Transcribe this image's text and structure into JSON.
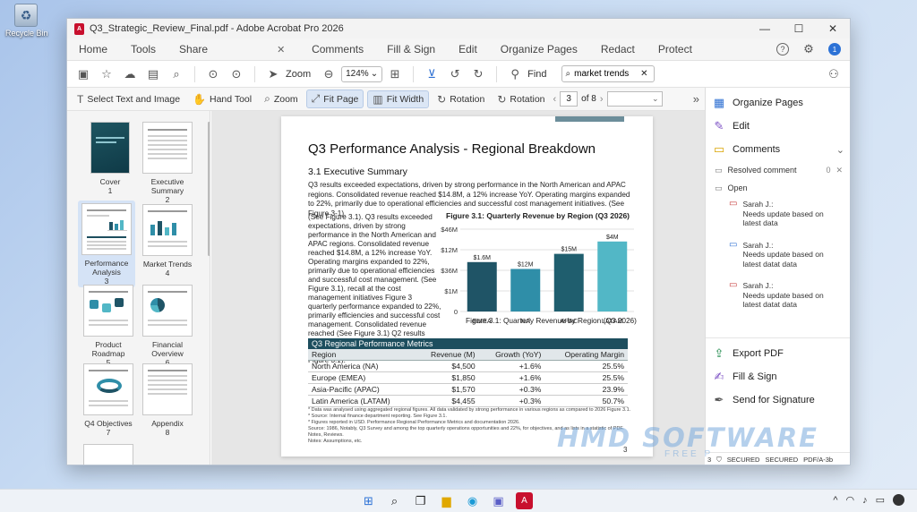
{
  "desktop": {
    "recycle_label": "Recycle Bin"
  },
  "window": {
    "title": "Q3_Strategic_Review_Final.pdf - Adobe Acrobat Pro 2026",
    "controls": {
      "minimize": "—",
      "maximize": "☐",
      "close": "✕"
    }
  },
  "menubar": {
    "left_tabs": [
      "Home",
      "Tools",
      "Share"
    ],
    "close_tab": "✕",
    "right_tabs": [
      "Comments",
      "Fill & Sign",
      "Edit",
      "Organize Pages",
      "Redact",
      "Protect"
    ],
    "help": "?",
    "user_initial": "1"
  },
  "toolbar1": {
    "zoom_label": "Zoom",
    "zoom_value": "124%",
    "find_label": "Find",
    "search_value": "market trends"
  },
  "toolbar2": {
    "select": "Select Text and Image",
    "hand": "Hand Tool",
    "zoom": "Zoom",
    "fit_page": "Fit Page",
    "fit_width": "Fit Width",
    "rotation1": "Rotation",
    "rotation2": "Rotation",
    "page_current": "3",
    "page_of": "of 8",
    "more": "»"
  },
  "thumbnails": [
    {
      "name": "Cover",
      "num": "1"
    },
    {
      "name": "Executive Summary",
      "num": "2"
    },
    {
      "name": "Performance Analysis",
      "num": "3"
    },
    {
      "name": "Market Trends",
      "num": "4"
    },
    {
      "name": "Product Roadmap",
      "num": "5"
    },
    {
      "name": "Financial Overview",
      "num": "6"
    },
    {
      "name": "Q4 Objectives",
      "num": "7"
    },
    {
      "name": "Appendix",
      "num": "8"
    }
  ],
  "document": {
    "title": "Q3 Performance Analysis - Regional Breakdown",
    "section": "3.1  Executive Summary",
    "paragraph": "Q3 results exceeded expectations, driven by strong performance in the North American and APAC regions. Consolidated revenue reached $14.8M, a 12% increase YoY. Operating margins expanded to 22%, primarily due to operational efficiencies and successful cost management initiatives. (See Figure 3-1).",
    "left_text": "(See Figure 3.1). Q3 results exceeded expectations, driven by strong performance in the North American and APAC regions. Consolidated revenue reached $14.8M, a 12% increase YoY. Operating margins expanded to 22%, primarily due to operational efficiencies and successful cost management. (See Figure 3.1), recall at the cost management initiatives Figure 3 quarterly performance expanded to 22%, primarily efficiencies and successful cost management. Consolidated revenue reached (See Figure 3.1) Q2 results exceeded operational efficiencies and successful cost management. (See Figure 3.1).",
    "chart_caption": "Figure 3.1: Quarterly Revenue by Region (Q3 2026)",
    "page_footer_num": "3",
    "footnotes": [
      "* Data was analysed using aggregated regional figures. All data validated by strong performance in various regions as compared to 2026 Figure 3.1.",
      "* Source: Internal finance department reporting. See Figure 3.1.",
      "* Figures reported in USD. Performance Regional Performance Metrics and documentation 2026.",
      "Source: 1986, Notably, Q3 Survey and among the top quarterly operations opportunities and 22%, for objectives, and as lists in a statistic of PDF. Notes, Reviews.",
      "Notes: Assumptions, etc."
    ]
  },
  "chart_data": {
    "type": "bar",
    "title": "Figure 3.1: Quarterly Revenue by Region (Q3 2026)",
    "categories": [
      "EMEA",
      "NA",
      "APAC",
      "LATAM"
    ],
    "values": [
      3.6,
      3.1,
      4.2,
      5.1
    ],
    "value_labels": [
      "$1.6M",
      "$12M",
      "$15M",
      "$4M"
    ],
    "y_ticks": [
      "0",
      "$1M",
      "$36M",
      "$12M",
      "$46M"
    ],
    "ylim": [
      0,
      6
    ],
    "colors": [
      "#1f5466",
      "#2f8ea8",
      "#1f5e6e",
      "#52b7c6"
    ],
    "grid": true,
    "legend": "none"
  },
  "metrics_table": {
    "caption": "Q3 Regional Performance Metrics",
    "headers": [
      "Region",
      "Revenue (M)",
      "Growth (YoY)",
      "Operating Margin"
    ],
    "rows": [
      [
        "North America (NA)",
        "$4,500",
        "+1.6%",
        "25.5%"
      ],
      [
        "Europe (EMEA)",
        "$1,850",
        "+1.6%",
        "25.5%"
      ],
      [
        "Asia-Pacific (APAC)",
        "$1,570",
        "+0.3%",
        "23.9%"
      ],
      [
        "Latin America (LATAM)",
        "$4,455",
        "+0.3%",
        "50.7%"
      ]
    ]
  },
  "right_panel": {
    "organize": "Organize Pages",
    "edit": "Edit",
    "comments": "Comments",
    "resolved": "Resolved comment",
    "resolved_count": "0",
    "open": "Open",
    "comment_list": [
      {
        "author": "Sarah J.:",
        "text": "Needs update based on latest data",
        "color": "red"
      },
      {
        "author": "Sarah J.:",
        "text": "Needs update based on latest datat data",
        "color": "blue"
      },
      {
        "author": "Sarah J.:",
        "text": "Needs update based on latest datat data",
        "color": "red"
      }
    ],
    "export": "Export PDF",
    "fill_sign": "Fill & Sign",
    "send_signature": "Send for Signature"
  },
  "statusbar": {
    "page": "3",
    "secured1": "SECURED",
    "secured2": "SECURED",
    "pdfa": "PDF/A-3b"
  },
  "watermark": {
    "main": "HMD SOFTWARE",
    "sub": "FREE P"
  },
  "taskbar": {
    "tray_more": "^"
  }
}
